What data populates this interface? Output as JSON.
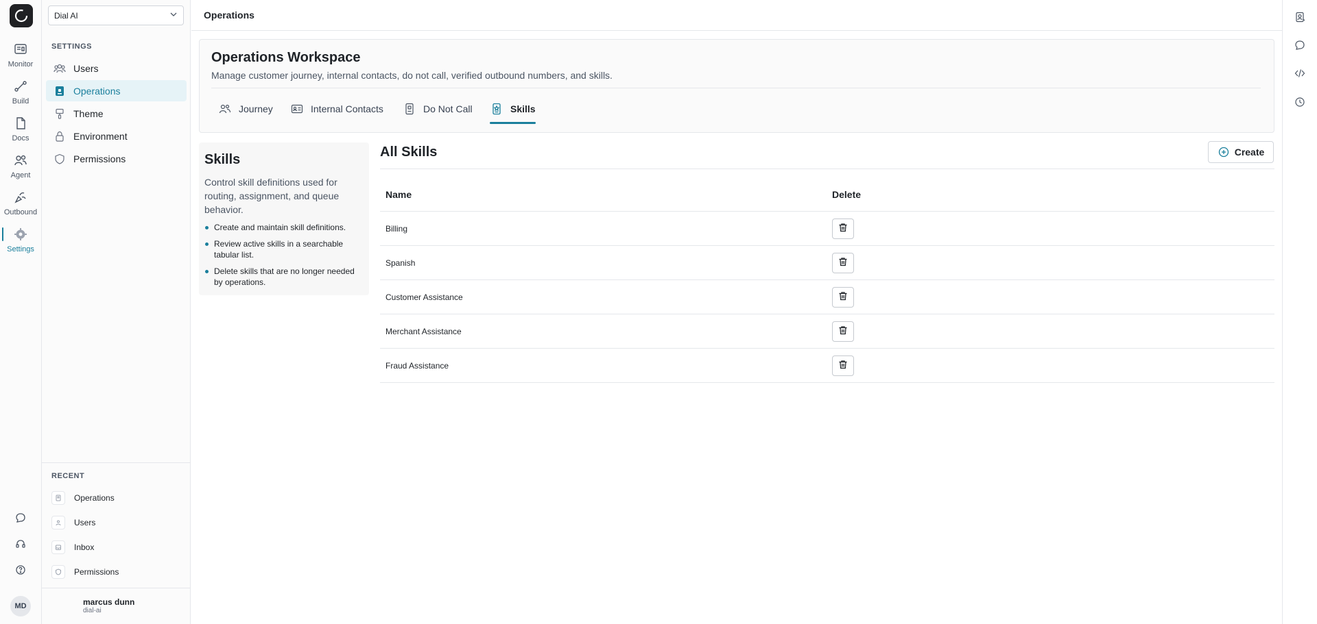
{
  "app": {
    "org_selector": "Dial AI",
    "page_title": "Operations"
  },
  "rail": {
    "items": [
      {
        "label": "Monitor",
        "icon": "monitor-icon"
      },
      {
        "label": "Build",
        "icon": "build-icon"
      },
      {
        "label": "Docs",
        "icon": "docs-icon"
      },
      {
        "label": "Agent",
        "icon": "agent-icon"
      },
      {
        "label": "Outbound",
        "icon": "outbound-icon"
      },
      {
        "label": "Settings",
        "icon": "gear-icon",
        "active": true
      }
    ],
    "bottom_icons": [
      "chat-icon",
      "headset-icon",
      "help-icon"
    ]
  },
  "sidebar": {
    "settings_heading": "SETTINGS",
    "items": [
      {
        "label": "Users",
        "icon": "users-icon"
      },
      {
        "label": "Operations",
        "icon": "operations-icon",
        "active": true
      },
      {
        "label": "Theme",
        "icon": "brush-icon"
      },
      {
        "label": "Environment",
        "icon": "lock-icon"
      },
      {
        "label": "Permissions",
        "icon": "shield-icon"
      }
    ],
    "recent_heading": "RECENT",
    "recent": [
      {
        "label": "Operations",
        "icon": "operations-icon"
      },
      {
        "label": "Users",
        "icon": "users-icon"
      },
      {
        "label": "Inbox",
        "icon": "inbox-icon"
      },
      {
        "label": "Permissions",
        "icon": "shield-icon"
      }
    ],
    "user": {
      "initials": "MD",
      "name": "marcus dunn",
      "org": "dial-ai"
    }
  },
  "workspace": {
    "title": "Operations Workspace",
    "description": "Manage customer journey, internal contacts, do not call, verified outbound numbers, and skills.",
    "tabs": [
      {
        "label": "Journey",
        "icon": "journey-icon"
      },
      {
        "label": "Internal Contacts",
        "icon": "contact-card-icon"
      },
      {
        "label": "Do Not Call",
        "icon": "do-not-call-icon"
      },
      {
        "label": "Skills",
        "icon": "skills-icon",
        "active": true
      }
    ]
  },
  "info": {
    "title": "Skills",
    "description": "Control skill definitions used for routing, assignment, and queue behavior.",
    "bullets": [
      "Create and maintain skill definitions.",
      "Review active skills in a searchable tabular list.",
      "Delete skills that are no longer needed by operations."
    ]
  },
  "skills": {
    "title": "All Skills",
    "create_label": "Create",
    "columns": [
      "Name",
      "Delete"
    ],
    "rows": [
      "Billing",
      "Spanish",
      "Customer Assistance",
      "Merchant Assistance",
      "Fraud Assistance"
    ]
  },
  "colors": {
    "accent": "#1a7f9c",
    "border": "#e5e7eb",
    "text": "#1f2328"
  },
  "right_rail_icons": [
    "contact-book-icon",
    "chat-bubble-icon",
    "code-icon",
    "history-icon"
  ]
}
